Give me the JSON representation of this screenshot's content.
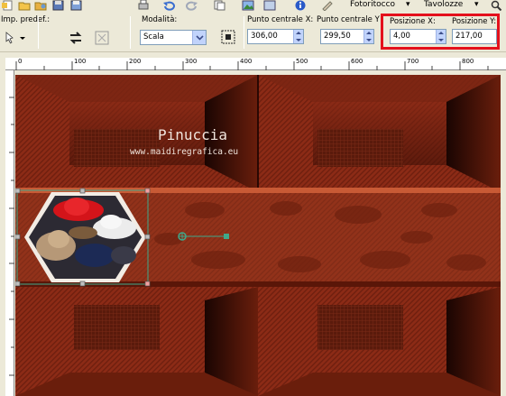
{
  "menu": {
    "fotoritocco": "Fotoritocco",
    "tavolozze": "Tavolozze"
  },
  "propbar": {
    "preset_label": "Imp. predef.:",
    "mode_label": "Modalità:",
    "mode_value": "Scala",
    "center_x_label": "Punto centrale X:",
    "center_x_value": "306,00",
    "center_y_label": "Punto centrale Y",
    "center_y_value": "299,50",
    "pos_x_label": "Posizione X:",
    "pos_x_value": "4,00",
    "pos_y_label": "Posizione Y:",
    "pos_y_value": "217,00"
  },
  "ruler": {
    "ticks": [
      "0",
      "100",
      "200",
      "300",
      "400",
      "500",
      "600",
      "700",
      "800"
    ]
  },
  "image": {
    "watermark_title": "Pinuccia",
    "watermark_url": "www.maidiregrafica.eu"
  },
  "colors": {
    "highlight": "#e4101c",
    "bg_dark": "#3a0e05",
    "bg_mid": "#8a2a16",
    "handle": "#3fa88a"
  }
}
